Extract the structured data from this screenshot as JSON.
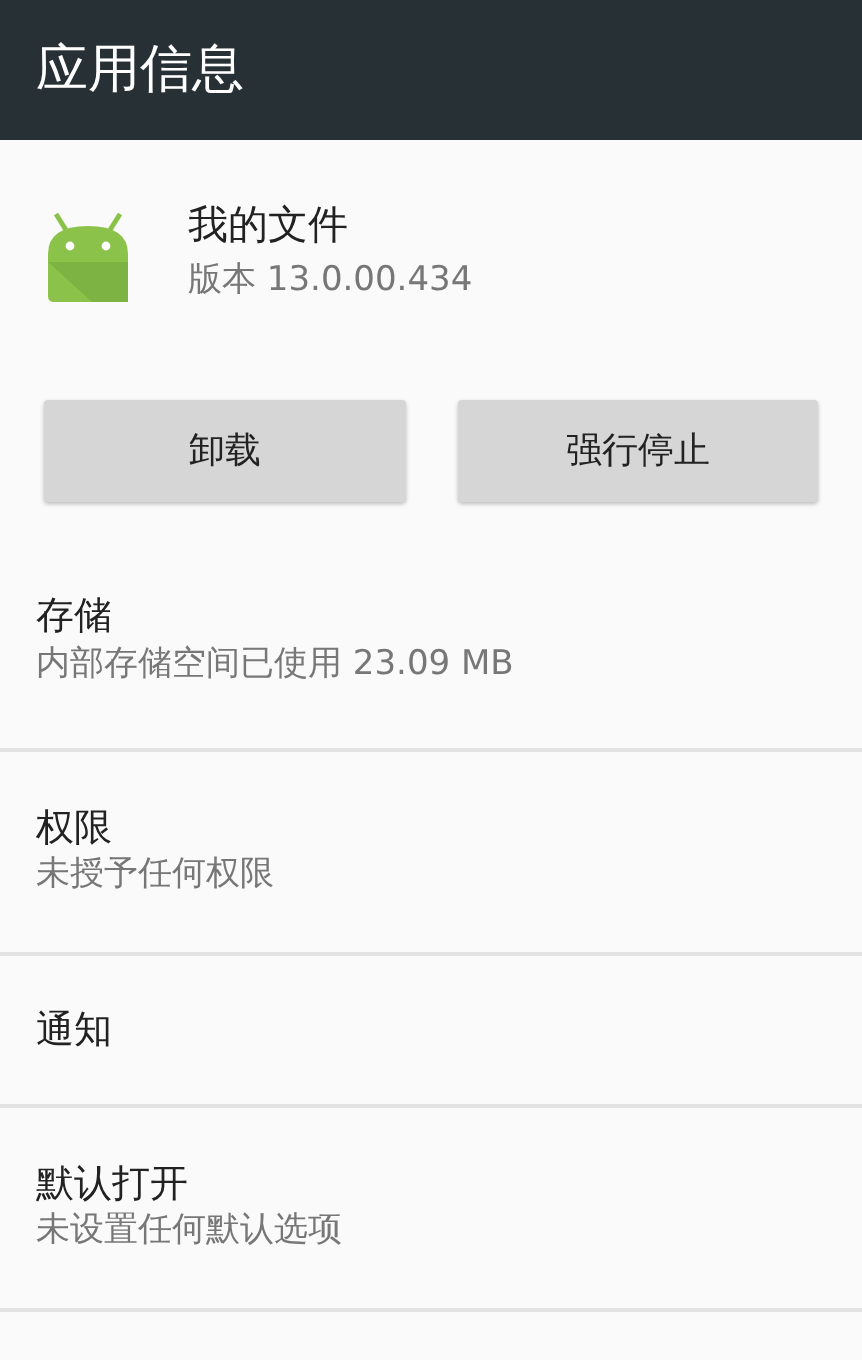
{
  "toolbar": {
    "title": "应用信息"
  },
  "app": {
    "name": "我的文件",
    "version": "版本 13.0.00.434"
  },
  "buttons": [
    "卸载",
    "强行停止"
  ],
  "sections": [
    {
      "title": "存储",
      "subtitle": "内部存储空间已使用 23.09 MB"
    },
    {
      "title": "权限",
      "subtitle": "未授予任何权限"
    },
    {
      "title": "通知"
    },
    {
      "title": "默认打开",
      "subtitle": "未设置任何默认选项"
    }
  ]
}
